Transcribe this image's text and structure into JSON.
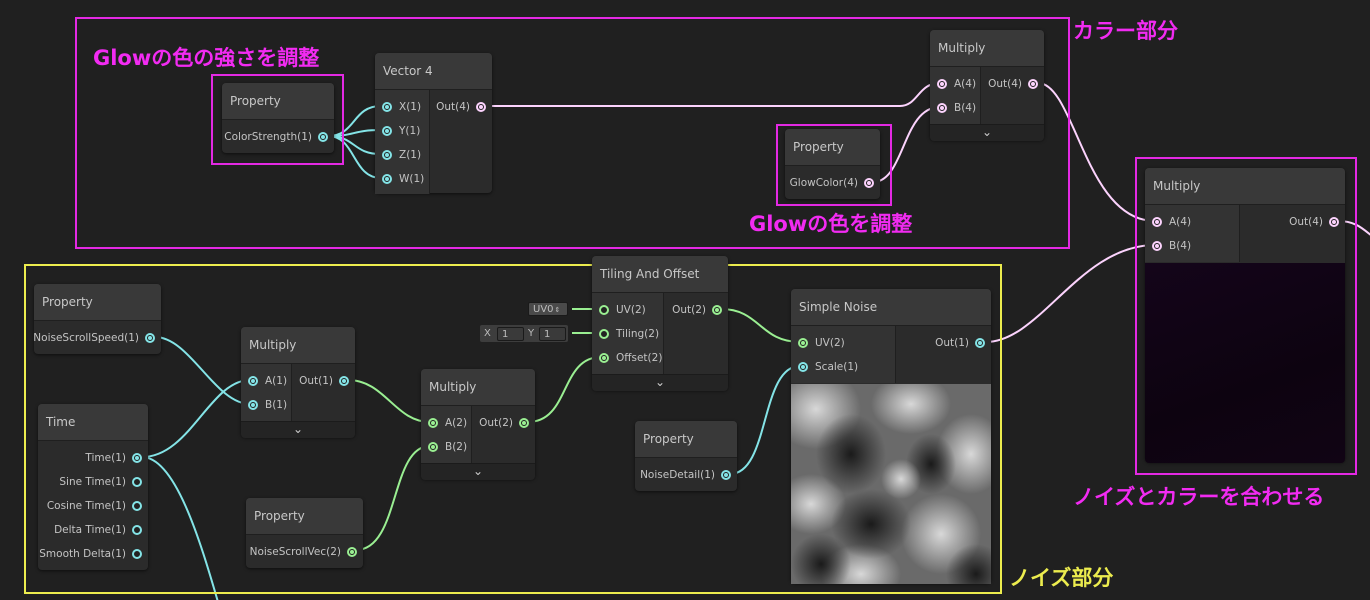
{
  "colors": {
    "background": "#202020",
    "annotation_magenta": "#f22bf2",
    "annotation_yellow": "#ecec4e",
    "port_vector1": "#84e4e7",
    "port_vector2": "#9aef92",
    "port_vector4": "#fcd3fd"
  },
  "annotations": {
    "color_part": "カラー部分",
    "glow_strength": "Glowの色の強さを調整",
    "glow_color": "Glowの色を調整",
    "combine": "ノイズとカラーを合わせる",
    "noise_part": "ノイズ部分"
  },
  "nodes": {
    "color_strength": {
      "title": "Property",
      "out": "ColorStrength(1)"
    },
    "vector4": {
      "title": "Vector 4",
      "inputs": [
        "X(1)",
        "Y(1)",
        "Z(1)",
        "W(1)"
      ],
      "out": "Out(4)"
    },
    "glow_color": {
      "title": "Property",
      "out": "GlowColor(4)"
    },
    "multiply_color": {
      "title": "Multiply",
      "inputs": [
        "A(4)",
        "B(4)"
      ],
      "out": "Out(4)",
      "collapse_icon": "chevron-down-icon"
    },
    "multiply_final": {
      "title": "Multiply",
      "inputs": [
        "A(4)",
        "B(4)"
      ],
      "out": "Out(4)"
    },
    "noise_scroll_speed": {
      "title": "Property",
      "out": "NoiseScrollSpeed(1)"
    },
    "time": {
      "title": "Time",
      "outputs": [
        "Time(1)",
        "Sine Time(1)",
        "Cosine Time(1)",
        "Delta Time(1)",
        "Smooth Delta(1)"
      ]
    },
    "multiply_1": {
      "title": "Multiply",
      "inputs": [
        "A(1)",
        "B(1)"
      ],
      "out": "Out(1)",
      "collapse_icon": "chevron-down-icon"
    },
    "multiply_2": {
      "title": "Multiply",
      "inputs": [
        "A(2)",
        "B(2)"
      ],
      "out": "Out(2)",
      "collapse_icon": "chevron-down-icon"
    },
    "noise_scroll_vec": {
      "title": "Property",
      "out": "NoiseScrollVec(2)"
    },
    "tiling_offset": {
      "title": "Tiling And Offset",
      "inputs": [
        "UV(2)",
        "Tiling(2)",
        "Offset(2)"
      ],
      "out": "Out(2)",
      "collapse_icon": "chevron-down-icon",
      "uv_field": "UV0",
      "uv_field_icon": "dropdown-arrows-icon",
      "tiling_x_label": "X",
      "tiling_x": "1",
      "tiling_y_label": "Y",
      "tiling_y": "1"
    },
    "simple_noise": {
      "title": "Simple Noise",
      "inputs": [
        "UV(2)",
        "Scale(1)"
      ],
      "out": "Out(1)"
    },
    "noise_detail": {
      "title": "Property",
      "out": "NoiseDetail(1)"
    }
  }
}
